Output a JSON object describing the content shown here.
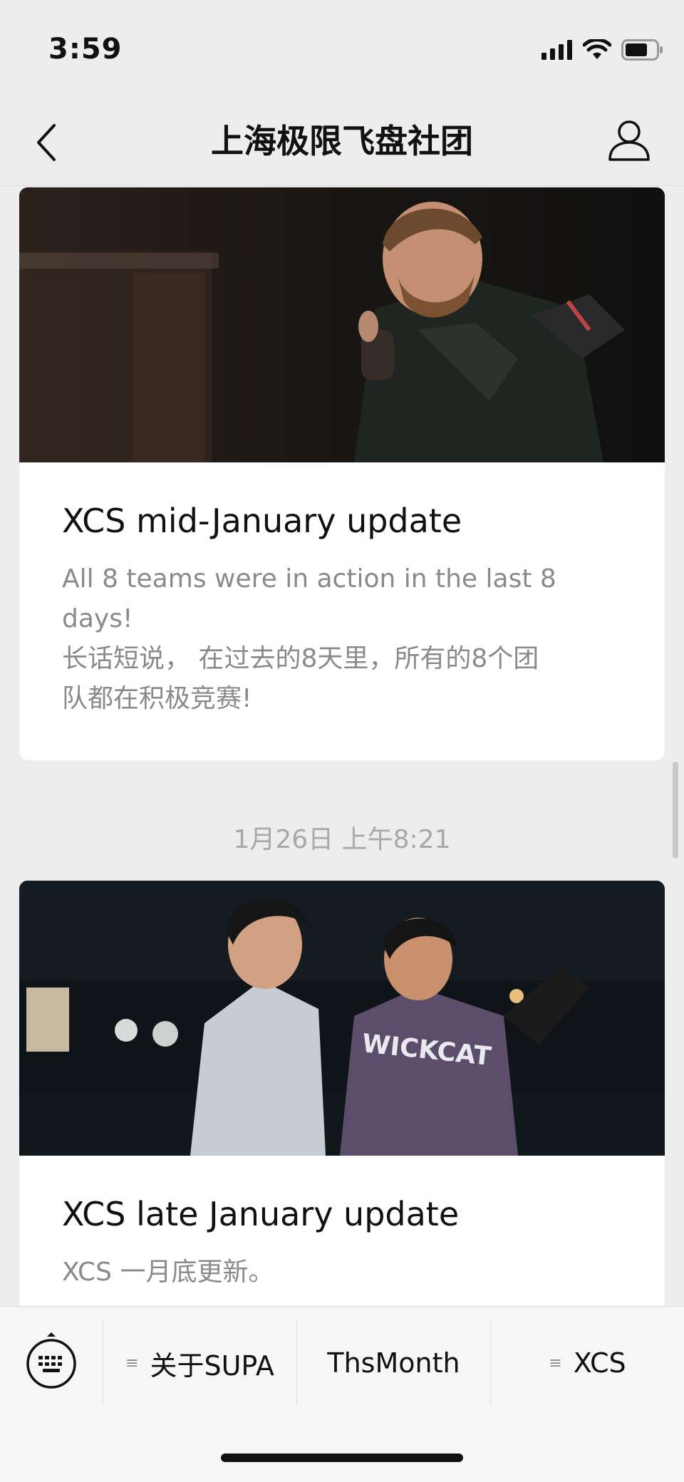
{
  "status_bar": {
    "time": "3:59"
  },
  "nav": {
    "title": "上海极限飞盘社团"
  },
  "articles": [
    {
      "title": "XCS mid-January update",
      "desc_lines": [
        "All 8 teams were in action in the last 8",
        "days!",
        "长话短说， 在过去的8天里，所有的8个团",
        "队都在积极竞赛!"
      ]
    },
    {
      "timestamp": "1月26日 上午8:21",
      "title": "XCS late January update",
      "desc_lines": [
        "XCS 一月底更新。"
      ]
    }
  ],
  "menu": {
    "items": [
      {
        "label": "关于SUPA",
        "has_submenu": true
      },
      {
        "label": "ThsMonth",
        "has_submenu": false
      },
      {
        "label": "XCS",
        "has_submenu": true
      }
    ]
  },
  "icons": {
    "back": "chevron-left-icon",
    "profile": "person-icon",
    "keyboard": "keyboard-icon",
    "menu_glyph": "≡"
  }
}
